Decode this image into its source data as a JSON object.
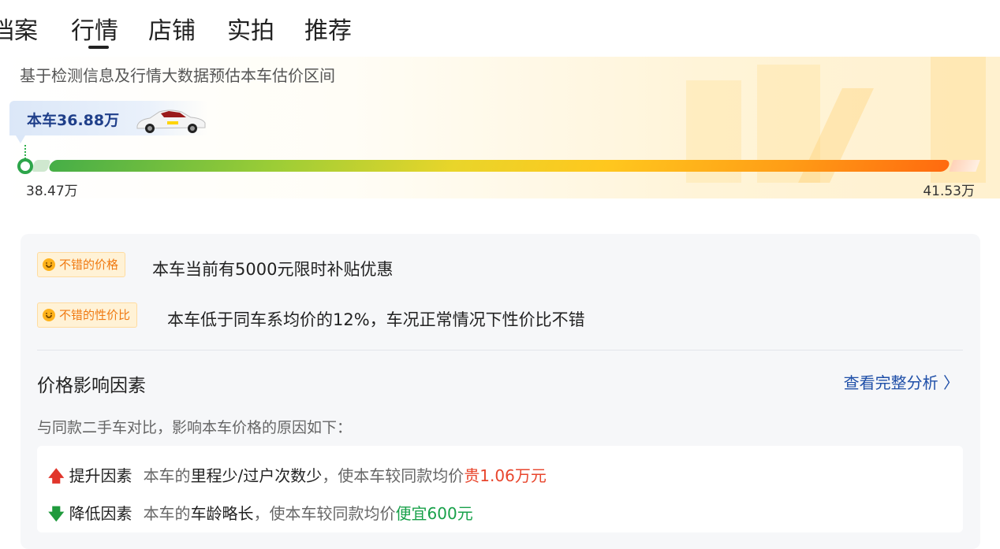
{
  "tabs": [
    "档案",
    "行情",
    "店铺",
    "实拍",
    "推荐"
  ],
  "active_tab": "行情",
  "valuation": {
    "subtitle": "基于检测信息及行情大数据预估本车估价区间",
    "this_car_label": "本车36.88万",
    "range_min": "38.47万",
    "range_max": "41.53万"
  },
  "tags": [
    {
      "label": "不错的价格",
      "text": "本车当前有5000元限时补贴优惠"
    },
    {
      "label": "不错的性价比",
      "text": "本车低于同车系均价的12%，车况正常情况下性价比不错"
    }
  ],
  "factors_section": {
    "title": "价格影响因素",
    "link": "查看完整分析 〉",
    "desc": "与同款二手车对比，影响本车价格的原因如下："
  },
  "factors": {
    "up": {
      "arrow": "🡅",
      "label": "提升因素",
      "p1": "本车的",
      "strong": "里程少/过户次数少",
      "p2": "，使本车较同款均价",
      "result": "贵1.06万元"
    },
    "down": {
      "arrow": "🡇",
      "label": "降低因素",
      "p1": "本车的",
      "strong": "车龄略长",
      "p2": "，使本车较同款均价",
      "result": "便宜600元"
    }
  },
  "colors": {
    "accent_blue": "#1f4fa8",
    "tag_orange": "#f07a12",
    "up_red": "#e8452c",
    "down_green": "#18a14a"
  }
}
